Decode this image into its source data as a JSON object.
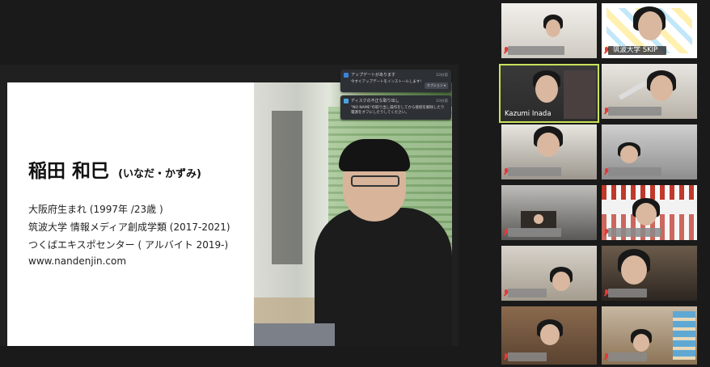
{
  "slide": {
    "name": "稲田 和巳",
    "name_kana": "(いなだ・かずみ)",
    "lines": [
      "大阪府生まれ (1997年 /23歳 )",
      "筑波大学 情報メディア創成学類 (2017-2021)",
      "つくばエキスポセンター ( アルバイト 2019-)",
      "www.nandenjin.com"
    ]
  },
  "notifications": [
    {
      "title": "アップデートがあります",
      "time": "10分前",
      "body": "今すぐアップデートをインストールします!",
      "button": "オプション ▾"
    },
    {
      "title": "ディスクの不正な取り出し",
      "time": "10分前",
      "body": "\"NO NAME\"の取り出し操作をしてから接続を解除したり電源をオフにしたりしてください。"
    }
  ],
  "participants": [
    {
      "label": ""
    },
    {
      "label": "筑波大学 SKIP"
    },
    {
      "label": ""
    },
    {
      "label": "Kazumi Inada"
    },
    {
      "label": ""
    },
    {
      "label": ""
    },
    {
      "label": ""
    },
    {
      "label": ""
    },
    {
      "label": ""
    },
    {
      "label": ""
    },
    {
      "label": ""
    },
    {
      "label": ""
    },
    {
      "label": ""
    },
    {
      "label": ""
    }
  ],
  "colors": {
    "background": "#1a1a1a",
    "active_speaker": "#c8e25a",
    "muted_icon": "#e53935"
  }
}
